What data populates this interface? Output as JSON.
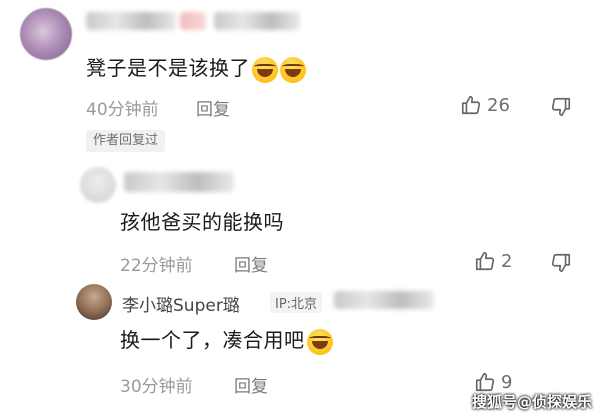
{
  "comments": [
    {
      "text": "凳子是不是该换了",
      "time": "40分钟前",
      "reply_label": "回复",
      "likes": "26",
      "author_tag": "作者回复过"
    },
    {
      "text": "孩他爸买的能换吗",
      "time": "22分钟前",
      "reply_label": "回复",
      "likes": "2"
    },
    {
      "username": "李小璐Super璐",
      "ip": "IP:北京",
      "text": "换一个了，凑合用吧",
      "time": "30分钟前",
      "reply_label": "回复",
      "likes": "9"
    }
  ],
  "icons": {
    "like": "thumbs-up-icon",
    "dislike": "thumbs-down-icon",
    "emoji": "laugh-cry-emoji-icon"
  },
  "watermark": "搜狐号@侦探娱乐"
}
